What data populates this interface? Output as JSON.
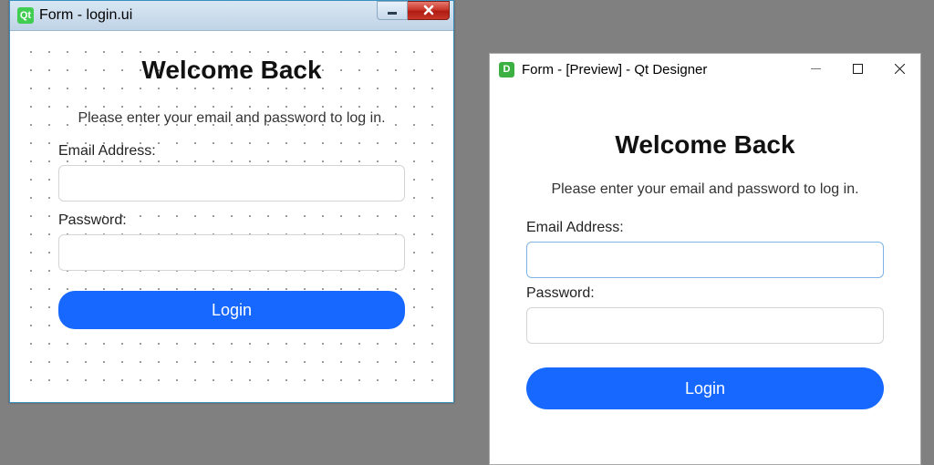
{
  "designer_window": {
    "icon_text": "Qt",
    "title": "Form - login.ui",
    "buttons": {
      "minimize": "minimize",
      "close": "close"
    }
  },
  "preview_window": {
    "icon_text": "D",
    "title": "Form - [Preview] - Qt Designer",
    "buttons": {
      "minimize": "minimize",
      "maximize": "maximize",
      "close": "close"
    }
  },
  "form": {
    "heading": "Welcome Back",
    "subtitle": "Please enter your email and password to log in.",
    "email_label": "Email Address:",
    "email_value": "",
    "password_label": "Password:",
    "password_value": "",
    "login_label": "Login"
  },
  "colors": {
    "primary_button": "#1668ff",
    "button_text": "#ffffff",
    "input_border": "#d4d4d4",
    "input_focus_border": "#7fb3e8",
    "background": "#808080",
    "qt_green": "#41cd52"
  }
}
